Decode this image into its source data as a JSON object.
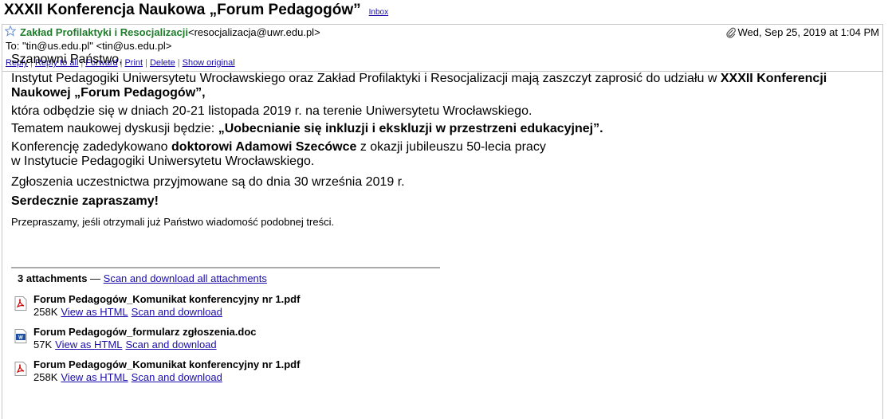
{
  "subject": "XXXII Konferencja Naukowa „Forum Pedagogów”",
  "label": "Inbox",
  "header": {
    "sender_name": "Zakład Profilaktyki i Resocjalizacji",
    "sender_email": "<resocjalizacja@uwr.edu.pl>",
    "date": "Wed, Sep 25, 2019 at 1:04 PM",
    "to": "To: \"tin@us.edu.pl\" <tin@us.edu.pl>"
  },
  "actions": [
    "Reply",
    "Reply to all",
    "Forward",
    "Print",
    "Delete",
    "Show original"
  ],
  "body": {
    "greeting": "Szanowni Państwo,",
    "intro_pre": "Instytut Pedagogiki Uniwersytetu Wrocławskiego oraz Zakład Profilaktyki i Resocjalizacji mają zaszczyt zaprosić do udziału w ",
    "intro_bold": "XXXII Konferencji Naukowej „Forum Pedagogów”,",
    "dates": "która odbędzie się w dniach 20-21 listopada 2019 r. na terenie Uniwersytetu Wrocławskiego.",
    "topic_pre": "Tematem naukowej dyskusji będzie: ",
    "topic_bold": "„Uobecnianie się inkluzji i ekskluzji w przestrzeni edukacyjnej”.",
    "dedication_pre": "Konferencję zadedykowano ",
    "dedication_bold": "doktorowi Adamowi Szecówce",
    "dedication_post": " z okazji jubileuszu 50-lecia pracy",
    "dedication_line2": "w Instytucie Pedagogiki Uniwersytetu Wrocławskiego.",
    "registration": "Zgłoszenia uczestnictwa przyjmowane są do dnia 30 września 2019 r.",
    "invitation": "Serdecznie zapraszamy!",
    "apology": "Przepraszamy, jeśli otrzymali już Państwo wiadomość podobnej treści."
  },
  "attachments": {
    "count_label": "3 attachments",
    "dash": " — ",
    "download_all": "Scan and download all attachments",
    "items": [
      {
        "name": "Forum Pedagogów_Komunikat konferencyjny nr 1.pdf",
        "size": "258K",
        "icon": "pdf-icon",
        "view": "View as HTML",
        "download": "Scan and download"
      },
      {
        "name": "Forum Pedagogów_formularz zgłoszenia.doc",
        "size": "57K",
        "icon": "doc-icon",
        "view": "View as HTML",
        "download": "Scan and download"
      },
      {
        "name": "Forum Pedagogów_Komunikat konferencyjny nr 1.pdf",
        "size": "258K",
        "icon": "pdf-icon",
        "view": "View as HTML",
        "download": "Scan and download"
      }
    ]
  },
  "colors": {
    "link": "#1a0dab",
    "sender": "#1e7c2b",
    "pdf": "#cc0000",
    "doc": "#1f4fa0"
  }
}
